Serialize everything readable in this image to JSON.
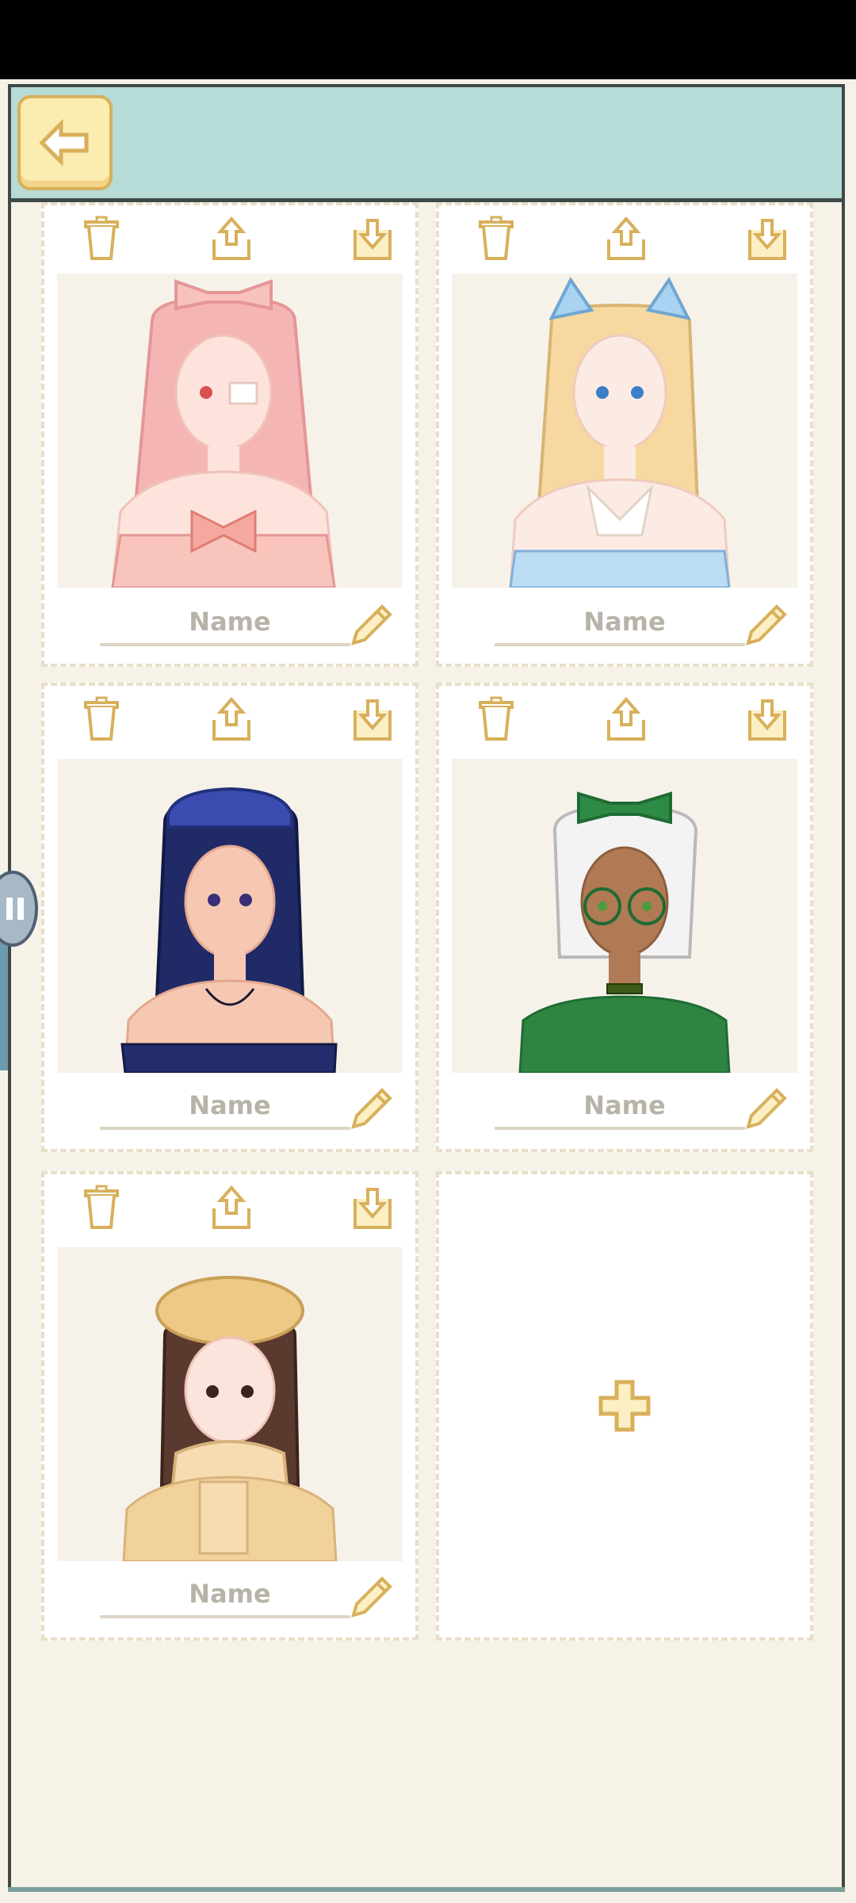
{
  "header": {
    "back_icon": "arrow-left-icon"
  },
  "colors": {
    "header": "#b7dbd6",
    "accent": "#d8b05b",
    "button_fill": "#fbecb0",
    "background": "#f6f2e8"
  },
  "slots": [
    {
      "name_placeholder": "Name",
      "portrait": "pink-hair-eyepatch-girl"
    },
    {
      "name_placeholder": "Name",
      "portrait": "blonde-cat-ears-girl"
    },
    {
      "name_placeholder": "Name",
      "portrait": "navy-hair-girl"
    },
    {
      "name_placeholder": "Name",
      "portrait": "white-hair-glasses-girl"
    },
    {
      "name_placeholder": "Name",
      "portrait": "beret-scarf-girl"
    }
  ],
  "toolbar_icons": [
    "trash-icon",
    "export-icon",
    "import-icon"
  ],
  "add_slot": {
    "icon": "plus-icon"
  }
}
